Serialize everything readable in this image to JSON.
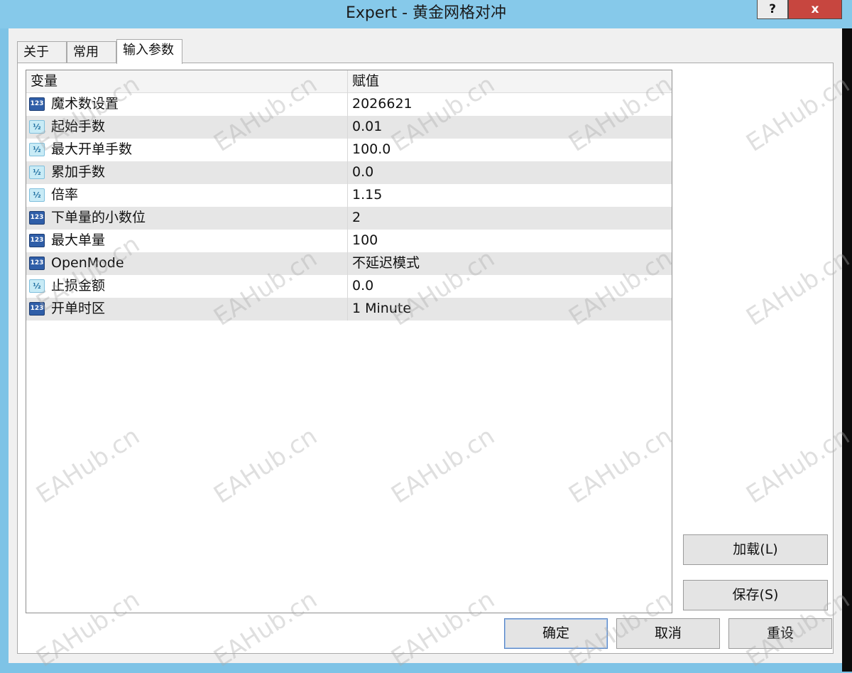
{
  "window": {
    "title": "Expert - 黄金网格对冲",
    "help_label": "?",
    "close_label": "x"
  },
  "tabs": [
    {
      "label": "关于"
    },
    {
      "label": "常用"
    },
    {
      "label": "输入参数"
    }
  ],
  "grid": {
    "headers": {
      "variable": "变量",
      "value": "赋值"
    },
    "rows": [
      {
        "name": "魔术数设置",
        "value": "2026621",
        "type": "int"
      },
      {
        "name": "起始手数",
        "value": "0.01",
        "type": "double"
      },
      {
        "name": "最大开单手数",
        "value": "100.0",
        "type": "double"
      },
      {
        "name": "累加手数",
        "value": "0.0",
        "type": "double"
      },
      {
        "name": "倍率",
        "value": "1.15",
        "type": "double"
      },
      {
        "name": "下单量的小数位",
        "value": "2",
        "type": "int"
      },
      {
        "name": "最大单量",
        "value": "100",
        "type": "int"
      },
      {
        "name": "OpenMode",
        "value": "不延迟模式",
        "type": "int"
      },
      {
        "name": "止损金额",
        "value": "0.0",
        "type": "double"
      },
      {
        "name": "开单时区",
        "value": "1 Minute",
        "type": "int"
      }
    ]
  },
  "icons": {
    "int": "123",
    "double": "½"
  },
  "side_buttons": {
    "load": "加载(L)",
    "save": "保存(S)"
  },
  "bottom_buttons": {
    "ok": "确定",
    "cancel": "取消",
    "reset": "重设"
  },
  "watermark": "EAHub.cn"
}
